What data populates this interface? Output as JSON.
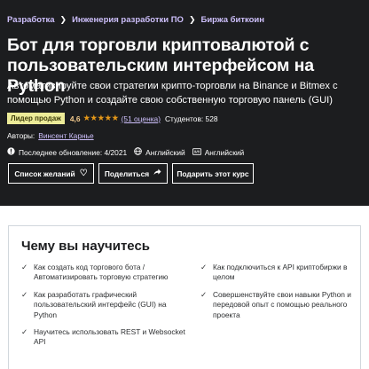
{
  "breadcrumb": [
    "Разработка",
    "Инженерия разработки ПО",
    "Биржа биткоин"
  ],
  "title": "Бот для торговли криптовалютой с пользовательским интерфейсом на Python",
  "subtitle": "Автоматизируйте свои стратегии крипто-торговли на Binance и Bitmex с помощью Python и создайте свою собственную торговую панель (GUI)",
  "badge": "Лидер продаж",
  "rating": "4,6",
  "stars": "★★★★★",
  "reviews": "(51 оценка)",
  "students": "Студентов: 528",
  "authors_label": "Авторы:",
  "author": "Винсент Карнье",
  "updated": "Последнее обновление: 4/2021",
  "language": "Английский",
  "captions": "Английский",
  "buttons": {
    "wishlist": "Список желаний",
    "share": "Поделиться",
    "gift": "Подарить этот курс"
  },
  "learn": {
    "title": "Чему вы научитесь",
    "items": [
      "Как создать код торгового бота / Автоматизировать торговую стратегию",
      "Как разработать графический пользовательский интерфейс (GUI) на Python",
      "Научитесь использовать REST и Websocket API",
      "Как подключиться к API криптобиржи в целом",
      "Совершенствуйте свои навыки Python и передовой опыт с помощью реального проекта"
    ]
  },
  "colors": {
    "hero_bg": "#1c1d1f",
    "link": "#cec0fc",
    "badge_bg": "#eceb98",
    "rating": "#f3ca8c",
    "stars": "#e59819"
  }
}
